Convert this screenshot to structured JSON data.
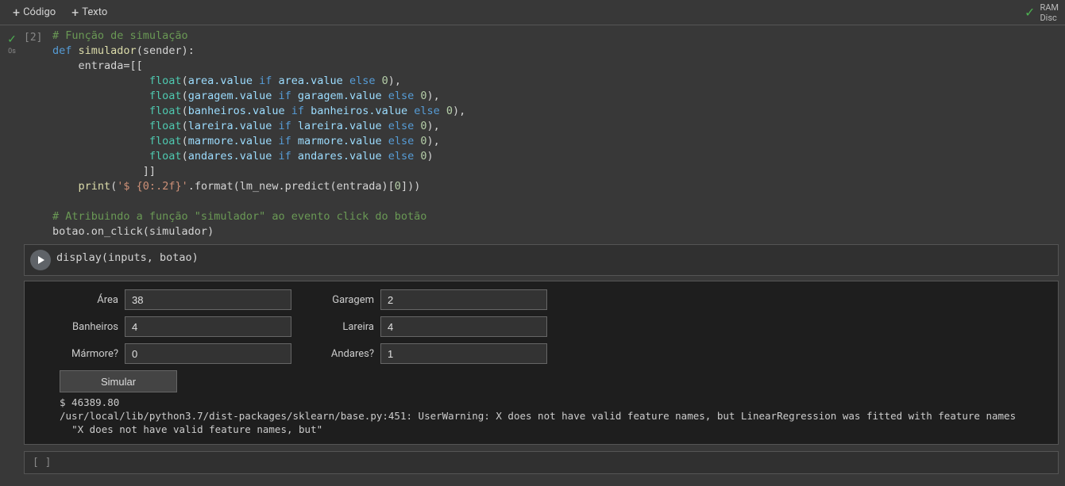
{
  "toolbar": {
    "code_btn": "Código",
    "text_btn": "Texto",
    "status_line1": "RAM",
    "status_line2": "Disc"
  },
  "cell1": {
    "prompt": "[2]",
    "exec_time": "0s",
    "code": {
      "l1": "# Função de simulação",
      "l2a": "def",
      "l2b": "simulador",
      "l2c": "(sender):",
      "l3": "    entrada=[[",
      "fl_kw": "float",
      "if_kw": "if",
      "else_kw": "else",
      "zero": "0",
      "l4v": "area.value",
      "l4v2": "area.value",
      "l5v": "garagem.value",
      "l5v2": "garagem.value",
      "l6v": "banheiros.value",
      "l6v2": "banheiros.value",
      "l7v": "lareira.value",
      "l7v2": "lareira.value",
      "l8v": "marmore.value",
      "l8v2": "marmore.value",
      "l9v": "andares.value",
      "l9v2": "andares.value",
      "l10": "              ]]",
      "l11a": "    print",
      "l11b": "'$ {0:.2f}'",
      "l11c": ".format(lm_new.predict(entrada)[",
      "l11d": "0",
      "l11e": "]))",
      "l12": "",
      "l13": "# Atribuindo a função \"simulador\" ao evento click do botão",
      "l14": "botao.on_click(simulador)"
    }
  },
  "cell2": {
    "code": "display(inputs, botao)"
  },
  "widgets": {
    "area_label": "Área",
    "area_value": "38",
    "garagem_label": "Garagem",
    "garagem_value": "2",
    "banheiros_label": "Banheiros",
    "banheiros_value": "4",
    "lareira_label": "Lareira",
    "lareira_value": "4",
    "marmore_label": "Mármore?",
    "marmore_value": "0",
    "andares_label": "Andares?",
    "andares_value": "1",
    "button_label": "Simular"
  },
  "output": {
    "result": "$ 46389.80",
    "warn1": "/usr/local/lib/python3.7/dist-packages/sklearn/base.py:451: UserWarning: X does not have valid feature names, but LinearRegression was fitted with feature names",
    "warn2": "  \"X does not have valid feature names, but\""
  },
  "cell3": {
    "prompt": "[ ]"
  }
}
